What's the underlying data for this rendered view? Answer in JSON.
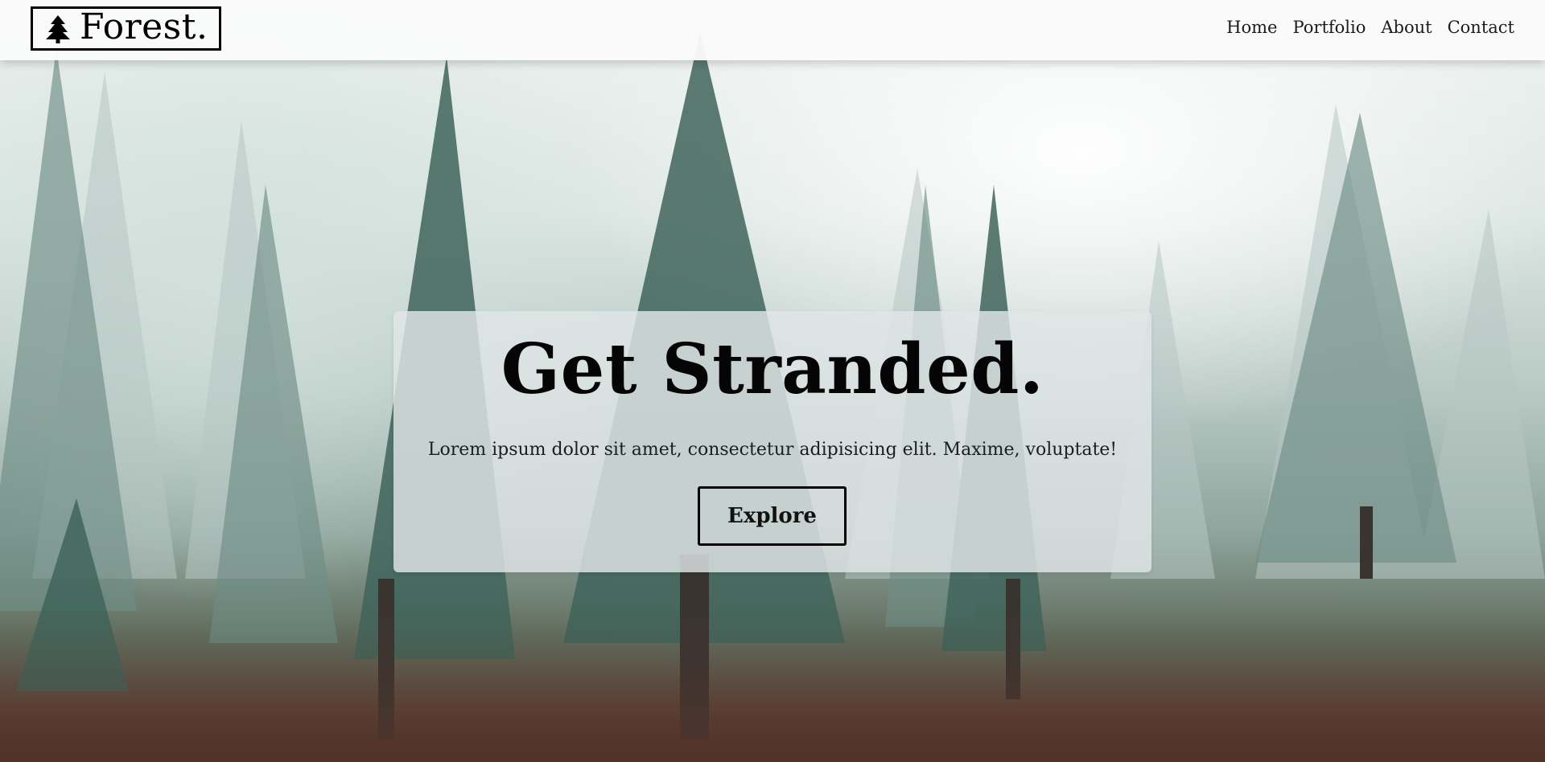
{
  "header": {
    "logo_text": "Forest.",
    "nav": [
      {
        "label": "Home"
      },
      {
        "label": "Portfolio"
      },
      {
        "label": "About"
      },
      {
        "label": "Contact"
      }
    ]
  },
  "hero": {
    "title": "Get Stranded.",
    "subtitle": "Lorem ipsum dolor sit amet, consectetur adipisicing elit. Maxime, voluptate!",
    "button_label": "Explore"
  },
  "icons": {
    "logo": "pine-tree-icon"
  },
  "colors": {
    "text": "#000000",
    "header_bg": "#fafafa",
    "card_bg": "#e1e5e7"
  }
}
